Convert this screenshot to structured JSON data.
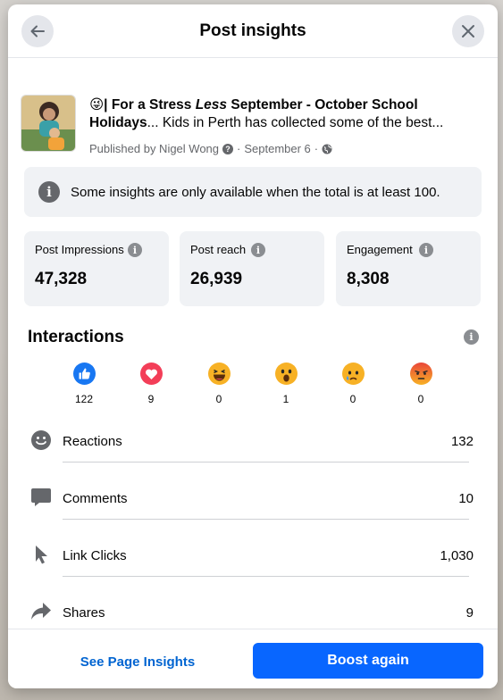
{
  "header": {
    "title": "Post insights"
  },
  "post": {
    "emoji": "😜",
    "title_part1": "| For a Stress ",
    "title_italic": "Less",
    "title_part2": " September - October School",
    "title_line2_bold": "Holidays",
    "title_line2_rest": "... Kids in Perth has collected some of the best...",
    "published_by": "Published by Nigel Wong",
    "date": "September 6"
  },
  "notice": {
    "text": "Some insights are only available when the total is at least 100."
  },
  "stats": [
    {
      "label": "Post Impressions",
      "value": "47,328"
    },
    {
      "label": "Post reach",
      "value": "26,939"
    },
    {
      "label": "Engagement",
      "value": "8,308"
    }
  ],
  "interactions": {
    "title": "Interactions",
    "reactions": [
      {
        "icon": "like-icon",
        "count": "122",
        "color": "#1877f2"
      },
      {
        "icon": "love-icon",
        "count": "9",
        "color": "#f33e58"
      },
      {
        "icon": "haha-icon",
        "count": "0",
        "color": "#f7b125"
      },
      {
        "icon": "wow-icon",
        "count": "1",
        "color": "#f7b125"
      },
      {
        "icon": "sad-icon",
        "count": "0",
        "color": "#f7b125"
      },
      {
        "icon": "angry-icon",
        "count": "0",
        "color": "#e9710f"
      }
    ],
    "rows": [
      {
        "icon": "smiley-icon",
        "label": "Reactions",
        "value": "132"
      },
      {
        "icon": "comment-icon",
        "label": "Comments",
        "value": "10"
      },
      {
        "icon": "cursor-icon",
        "label": "Link Clicks",
        "value": "1,030"
      },
      {
        "icon": "share-icon",
        "label": "Shares",
        "value": "9"
      }
    ]
  },
  "footer": {
    "see_insights": "See Page Insights",
    "boost": "Boost again"
  },
  "colors": {
    "primary": "#0866ff",
    "link": "#0064d1",
    "muted": "#65676b"
  }
}
